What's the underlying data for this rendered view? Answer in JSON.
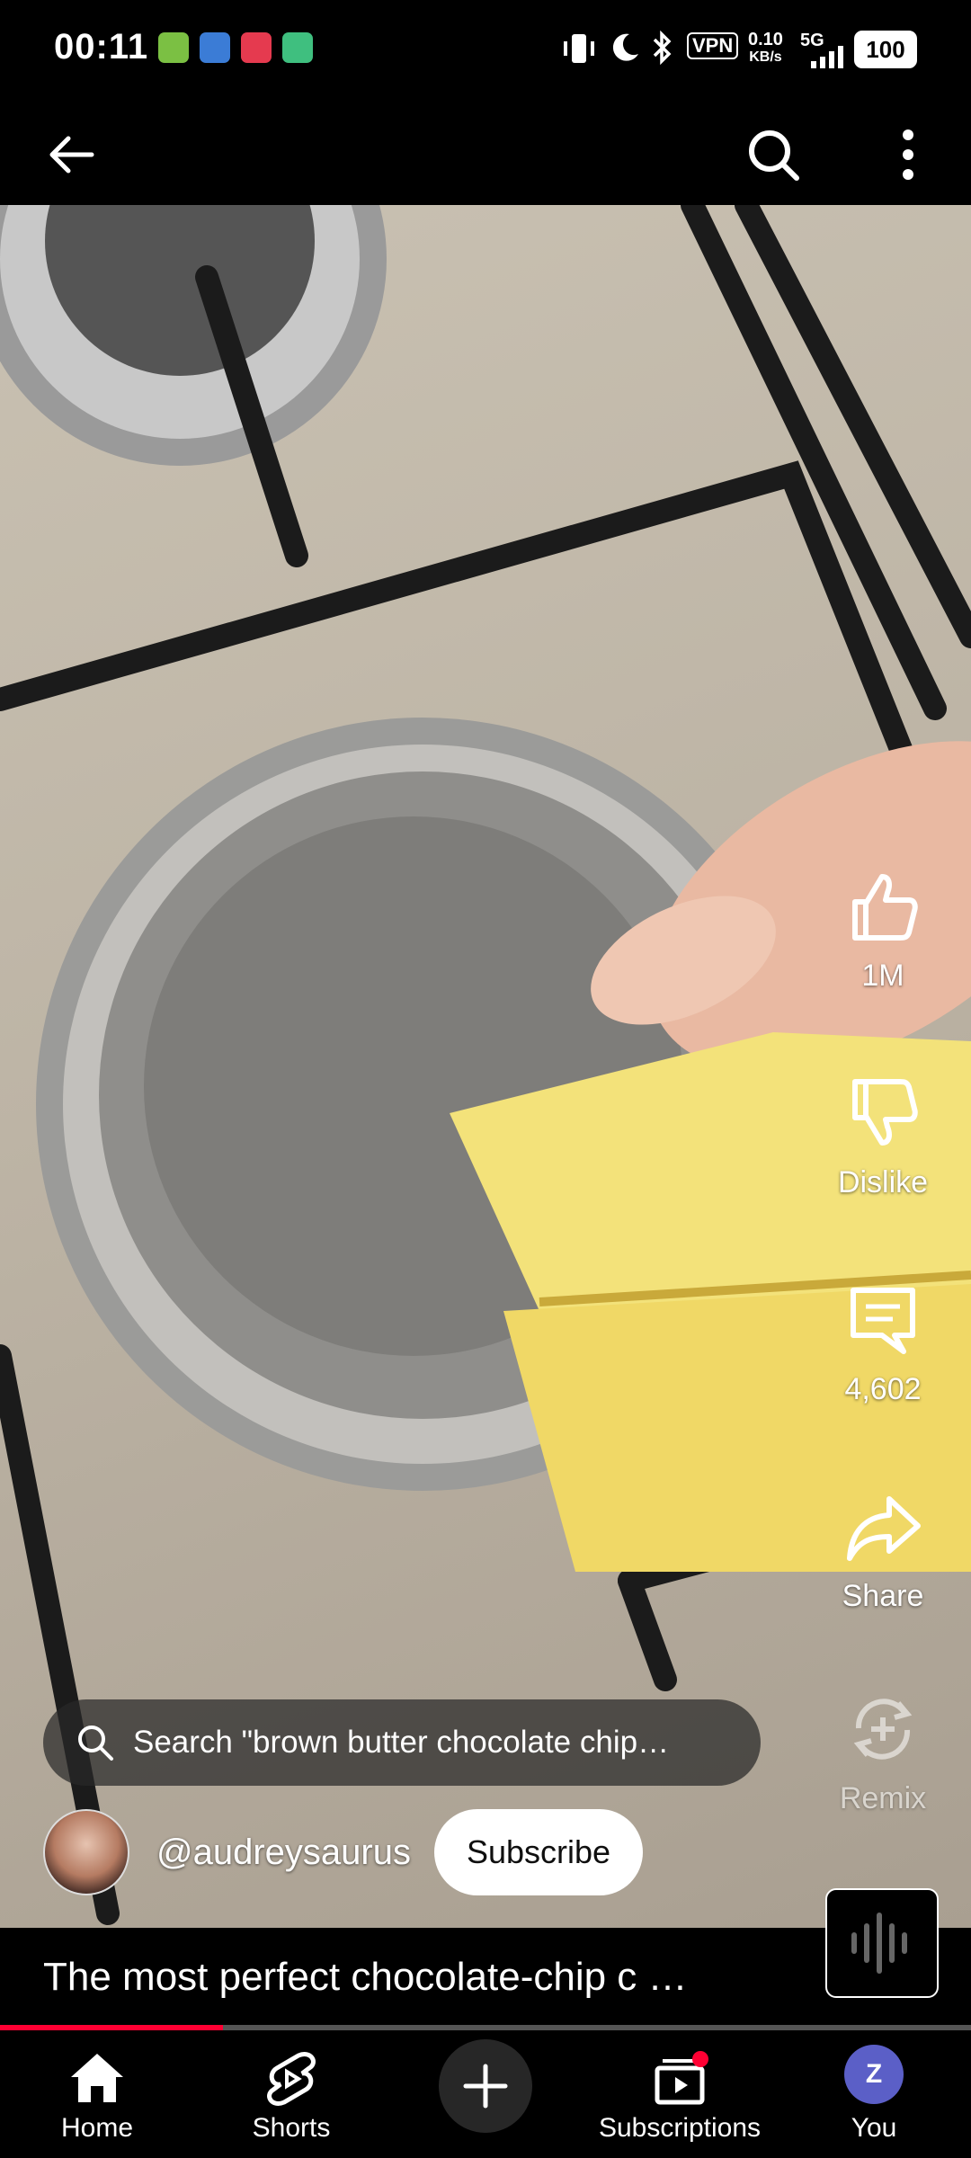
{
  "status_bar": {
    "time": "00:11",
    "vpn": "VPN",
    "speed_value": "0.10",
    "speed_unit": "KB/s",
    "network": "5G",
    "battery": "100"
  },
  "topbar": {
    "back_icon": "arrow-left-icon",
    "search_icon": "search-icon",
    "more_icon": "more-vertical-icon"
  },
  "actions": {
    "like_count": "1M",
    "dislike_label": "Dislike",
    "comment_count": "4,602",
    "share_label": "Share",
    "remix_label": "Remix"
  },
  "search_suggestion": "Search \"brown butter chocolate chip…",
  "channel": {
    "handle": "@audreysaurus",
    "subscribe_label": "Subscribe"
  },
  "video": {
    "title": "The most perfect chocolate-chip c …",
    "progress": 0.23
  },
  "nav": {
    "items": [
      {
        "label": "Home"
      },
      {
        "label": "Shorts"
      },
      {
        "label": ""
      },
      {
        "label": "Subscriptions"
      },
      {
        "label": "You"
      }
    ],
    "avatar_letter": "Z"
  },
  "colors": {
    "accent": "#ff0033",
    "subscribe_bg": "#ffffff",
    "avatar_bg": "#5b5fc7"
  }
}
